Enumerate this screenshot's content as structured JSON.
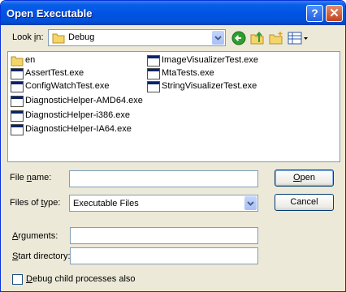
{
  "window": {
    "title": "Open Executable",
    "help_glyph": "?",
    "close_glyph": "✕"
  },
  "look_in": {
    "label_prefix": "Look ",
    "label_hot": "i",
    "label_suffix": "n:",
    "value": "Debug"
  },
  "files_left": [
    "en",
    "AssertTest.exe",
    "ConfigWatchTest.exe",
    "DiagnosticHelper-AMD64.exe",
    "DiagnosticHelper-i386.exe",
    "DiagnosticHelper-IA64.exe"
  ],
  "files_right": [
    "ImageVisualizerTest.exe",
    "MtaTests.exe",
    "StringVisualizerTest.exe"
  ],
  "file_name": {
    "label_prefix": "File ",
    "label_hot": "n",
    "label_suffix": "ame:",
    "value": ""
  },
  "file_type": {
    "label_prefix": "Files of ",
    "label_hot": "t",
    "label_suffix": "ype:",
    "value": "Executable Files"
  },
  "arguments": {
    "label_hot": "A",
    "label_suffix": "rguments:",
    "value": ""
  },
  "start_dir": {
    "label_hot": "S",
    "label_suffix": "tart directory:",
    "value": ""
  },
  "debug_child": {
    "label_hot": "D",
    "label_suffix": "ebug child processes also",
    "checked": false
  },
  "buttons": {
    "open_hot": "O",
    "open_suffix": "pen",
    "cancel": "Cancel"
  },
  "colors": {
    "titlebar": "#0054e3",
    "dialog_bg": "#ece9d8",
    "field_border": "#7f9db9"
  }
}
